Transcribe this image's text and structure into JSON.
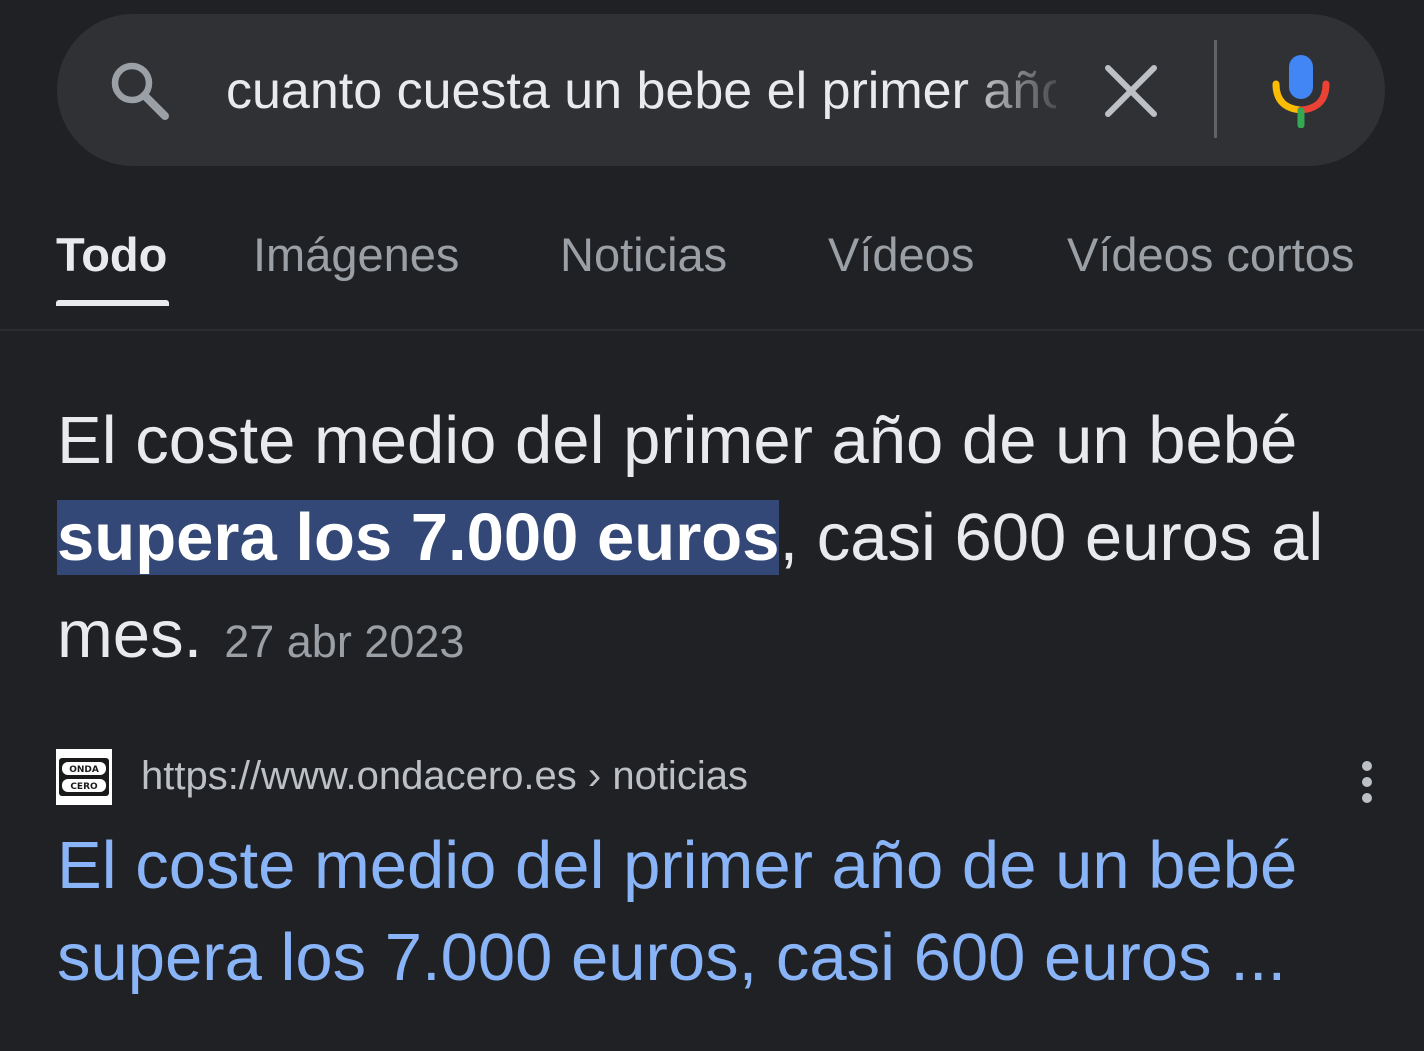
{
  "search": {
    "query": "cuanto cuesta un bebe el primer año"
  },
  "tabs": [
    {
      "label": "Todo",
      "active": true
    },
    {
      "label": "Imágenes",
      "active": false
    },
    {
      "label": "Noticias",
      "active": false
    },
    {
      "label": "Vídeos",
      "active": false
    },
    {
      "label": "Vídeos cortos",
      "active": false
    }
  ],
  "snippet": {
    "text_before": "El coste medio del primer año de un bebé ",
    "highlight": "supera los 7.000 euros",
    "text_after": ", casi 600 euros al mes.",
    "date": "27 abr 2023"
  },
  "result": {
    "site_url": "https://www.ondacero.es",
    "path": " › noticias",
    "title": "El coste medio del primer año de un bebé supera los 7.000 euros, casi 600 euros ...",
    "favicon_text": [
      "ONDA",
      "CERO"
    ]
  },
  "colors": {
    "background": "#202124",
    "search_bar": "#303134",
    "highlight": "#344878",
    "link": "#8ab4f8",
    "muted": "#9aa0a6"
  },
  "icons": {
    "search": "search-icon",
    "clear": "close-icon",
    "mic": "microphone-icon",
    "more": "more-vert-icon"
  }
}
